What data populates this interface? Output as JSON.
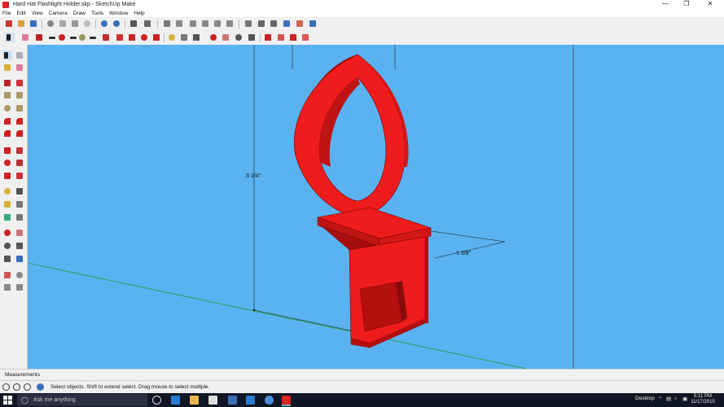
{
  "window": {
    "title": "Hard Hat Flashlight Holder.skp - SketchUp Make",
    "minimize_glyph": "—",
    "maximize_glyph": "❐",
    "close_glyph": "✕"
  },
  "menu": [
    "File",
    "Edit",
    "View",
    "Camera",
    "Draw",
    "Tools",
    "Window",
    "Help"
  ],
  "viewport": {
    "background": "#5ab3f0",
    "model_color": "#ee1c1c",
    "dimension_height": "3 1/4\"",
    "dimension_depth": "1 3/8\""
  },
  "measurements": {
    "label": "Measurements",
    "value": ""
  },
  "status": {
    "message": "Select objects. Shift to extend select. Drag mouse to select multiple."
  },
  "taskbar": {
    "search_placeholder": "Ask me anything",
    "desktop_label": "Desktop",
    "time": "5:11 PM",
    "date": "11/17/2015",
    "accent": "#101624"
  }
}
